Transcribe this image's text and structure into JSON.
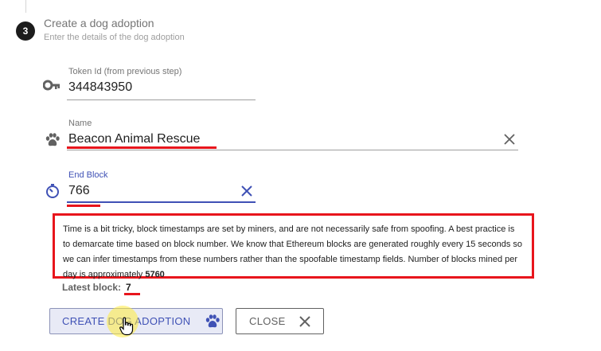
{
  "step": {
    "number": "3",
    "title": "Create a dog adoption",
    "subtitle": "Enter the details of the dog adoption"
  },
  "fields": {
    "token_id": {
      "label": "Token Id (from previous step)",
      "value": "344843950",
      "icon": "key-icon"
    },
    "name": {
      "label": "Name",
      "value": "Beacon Animal Rescue",
      "icon": "paw-icon"
    },
    "end_block": {
      "label": "End Block",
      "value": "766",
      "icon": "timer-icon"
    }
  },
  "info": {
    "text": "Time is a bit tricky, block timestamps are set by miners, and are not necessarily safe from spoofing. A best practice is to demarcate time based on block number. We know that Ethereum blocks are generated roughly every 15 seconds so we can infer timestamps from these numbers rather than the spoofable timestamp fields. Number of blocks mined per day is approximately ",
    "blocks_per_day": "5760"
  },
  "latest_block": {
    "label": "Latest block:",
    "value": "7"
  },
  "buttons": {
    "create": "CREATE DOG ADOPTION",
    "close": "CLOSE"
  },
  "colors": {
    "accent": "#3f51b5",
    "annotation_red": "#e8151c"
  }
}
